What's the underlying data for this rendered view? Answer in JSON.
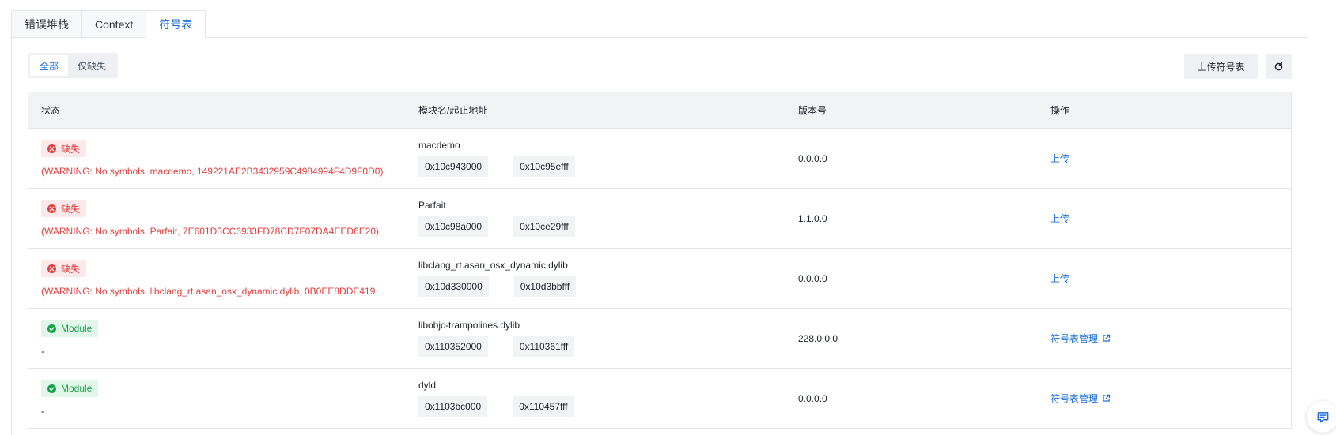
{
  "tabs": [
    {
      "label": "错误堆栈"
    },
    {
      "label": "Context"
    },
    {
      "label": "符号表"
    }
  ],
  "filter": {
    "all": "全部",
    "missing_only": "仅缺失"
  },
  "toolbar": {
    "upload": "上传符号表"
  },
  "table": {
    "headers": {
      "status": "状态",
      "module": "模块名/起止地址",
      "version": "版本号",
      "action": "操作"
    },
    "rows": [
      {
        "status": "缺失",
        "detail": "(WARNING: No symbols, macdemo, 149221AE2B3432959C4984994F4D9F0D0)",
        "module": "macdemo",
        "start": "0x10c943000",
        "end": "0x10c95efff",
        "version": "0.0.0.0",
        "action": "上传"
      },
      {
        "status": "缺失",
        "detail": "(WARNING: No symbols, Parfait, 7E601D3CC6933FD78CD7F07DA4EED6E20)",
        "module": "Parfait",
        "start": "0x10c98a000",
        "end": "0x10ce29fff",
        "version": "1.1.0.0",
        "action": "上传"
      },
      {
        "status": "缺失",
        "detail": "(WARNING: No symbols, libclang_rt.asan_osx_dynamic.dylib, 0B0EE8DDE4193…",
        "module": "libclang_rt.asan_osx_dynamic.dylib",
        "start": "0x10d330000",
        "end": "0x10d3bbfff",
        "version": "0.0.0.0",
        "action": "上传"
      },
      {
        "status": "Module",
        "detail": "-",
        "module": "libobjc-trampolines.dylib",
        "start": "0x110352000",
        "end": "0x110361fff",
        "version": "228.0.0.0",
        "action": "符号表管理"
      },
      {
        "status": "Module",
        "detail": "-",
        "module": "dyld",
        "start": "0x1103bc000",
        "end": "0x110457fff",
        "version": "0.0.0.0",
        "action": "符号表管理"
      }
    ]
  },
  "colors": {
    "accent": "#1e6fd9",
    "error": "#e53e3e",
    "success": "#1aa34a"
  },
  "icons": {
    "refresh": "refresh-icon",
    "external": "external-link-icon",
    "chat": "chat-icon"
  }
}
